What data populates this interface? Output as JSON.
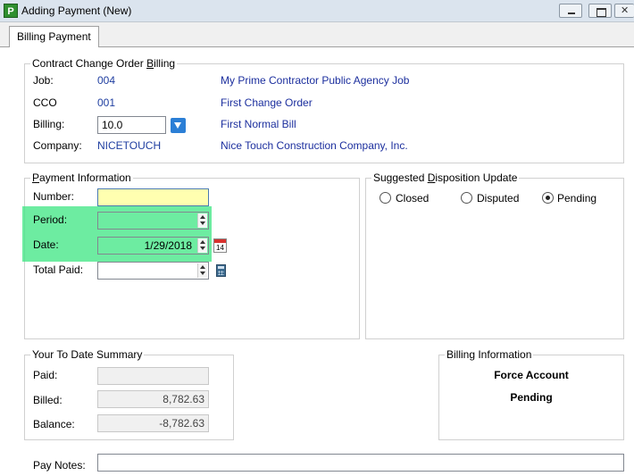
{
  "window": {
    "icon_letter": "P",
    "title": "Adding Payment  (New)"
  },
  "tabs": [
    {
      "label": "Billing Payment"
    }
  ],
  "cco_billing": {
    "legend": "Contract Change Order Billing",
    "job_label": "Job:",
    "job_code": "004",
    "job_name": "My Prime Contractor Public Agency Job",
    "cco_label": "CCO",
    "cco_code": "001",
    "cco_name": "First Change Order",
    "billing_label": "Billing:",
    "billing_value": "10.0",
    "billing_name": "First Normal Bill",
    "company_label": "Company:",
    "company_code": "NICETOUCH",
    "company_name": "Nice Touch Construction Company, Inc."
  },
  "payment_info": {
    "legend": "Payment Information",
    "number_label": "Number:",
    "number_value": "",
    "period_label": "Period:",
    "period_value": "",
    "date_label": "Date:",
    "date_value": "1/29/2018",
    "total_paid_label": "Total Paid:",
    "total_paid_value": "",
    "calendar_icon_text": "14"
  },
  "disposition": {
    "legend": "Suggested Disposition Update",
    "options": [
      {
        "label": "Closed",
        "checked": false
      },
      {
        "label": "Disputed",
        "checked": false
      },
      {
        "label": "Pending",
        "checked": true
      }
    ]
  },
  "summary": {
    "legend": "Your To Date Summary",
    "paid_label": "Paid:",
    "paid_value": "",
    "billed_label": "Billed:",
    "billed_value": "8,782.63",
    "balance_label": "Balance:",
    "balance_value": "-8,782.63"
  },
  "billing_information": {
    "legend": "Billing Information",
    "line1": "Force Account",
    "line2": "Pending"
  },
  "pay_notes": {
    "label": "Pay Notes:",
    "value": ""
  },
  "colors": {
    "highlight": "#3ce682",
    "link": "#1c2f9e",
    "required_field": "#ffffb0"
  }
}
